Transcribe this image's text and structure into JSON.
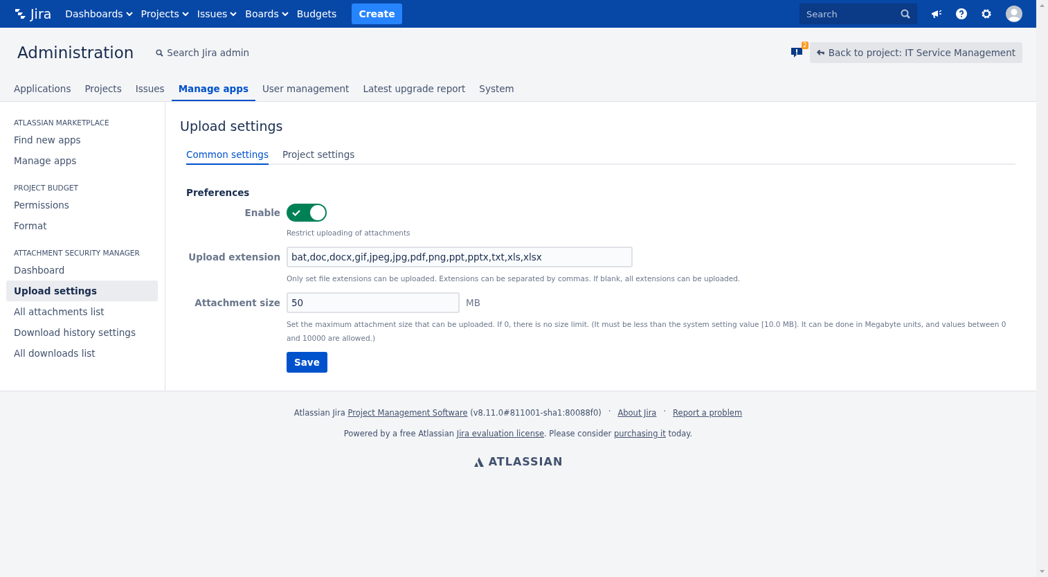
{
  "topbar": {
    "product": "Jira",
    "nav": [
      {
        "label": "Dashboards",
        "menu": true
      },
      {
        "label": "Projects",
        "menu": true
      },
      {
        "label": "Issues",
        "menu": true
      },
      {
        "label": "Boards",
        "menu": true
      },
      {
        "label": "Budgets",
        "menu": false
      }
    ],
    "create": "Create",
    "search": {
      "placeholder": "Search"
    }
  },
  "header": {
    "title": "Administration",
    "search_link": "Search Jira admin",
    "notification_count": "2",
    "back_button": "Back to project: IT Service Management",
    "tabs": [
      {
        "label": "Applications",
        "selected": false
      },
      {
        "label": "Projects",
        "selected": false
      },
      {
        "label": "Issues",
        "selected": false
      },
      {
        "label": "Manage apps",
        "selected": true
      },
      {
        "label": "User management",
        "selected": false
      },
      {
        "label": "Latest upgrade report",
        "selected": false
      },
      {
        "label": "System",
        "selected": false
      }
    ]
  },
  "sidebar": {
    "sections": [
      {
        "heading": "ATLASSIAN MARKETPLACE",
        "items": [
          {
            "label": "Find new apps",
            "selected": false
          },
          {
            "label": "Manage apps",
            "selected": false
          }
        ]
      },
      {
        "heading": "PROJECT BUDGET",
        "items": [
          {
            "label": "Permissions",
            "selected": false
          },
          {
            "label": "Format",
            "selected": false
          }
        ]
      },
      {
        "heading": "ATTACHMENT SECURITY MANAGER",
        "items": [
          {
            "label": "Dashboard",
            "selected": false
          },
          {
            "label": "Upload settings",
            "selected": true
          },
          {
            "label": "All attachments list",
            "selected": false
          },
          {
            "label": "Download history settings",
            "selected": false
          },
          {
            "label": "All downloads list",
            "selected": false
          }
        ]
      }
    ]
  },
  "content": {
    "title": "Upload settings",
    "tabs": [
      {
        "label": "Common settings",
        "selected": true
      },
      {
        "label": "Project settings",
        "selected": false
      }
    ],
    "section": "Preferences",
    "enable": {
      "label": "Enable",
      "checked": true,
      "description": "Restrict uploading of attachments"
    },
    "upload_extension": {
      "label": "Upload extension",
      "value": "bat,doc,docx,gif,jpeg,jpg,pdf,png,ppt,pptx,txt,xls,xlsx",
      "description": "Only set file extensions can be uploaded. Extensions can be separated by commas. If blank, all extensions can be uploaded."
    },
    "attachment_size": {
      "label": "Attachment size",
      "value": "50",
      "unit": "MB",
      "description": "Set the maximum attachment size that can be uploaded. If 0, there is no size limit. (It must be less than the system setting value [10.0 MB]. It can be done in Megabyte units, and values between 0 and 10000 are allowed.)"
    },
    "save": "Save"
  },
  "footer": {
    "line_1": {
      "prefix": "Atlassian Jira ",
      "link": "Project Management Software",
      "suffix": " (v8.11.0#811001-sha1:80088f0)"
    },
    "separator": "·",
    "links": [
      "About Jira",
      "Report a problem"
    ],
    "line_2": {
      "before": "Powered by a free Atlassian ",
      "link_1": "Jira evaluation license",
      "middle": ". Please consider ",
      "link_2": "purchasing it",
      "after": " today."
    },
    "brand": "ATLASSIAN"
  }
}
